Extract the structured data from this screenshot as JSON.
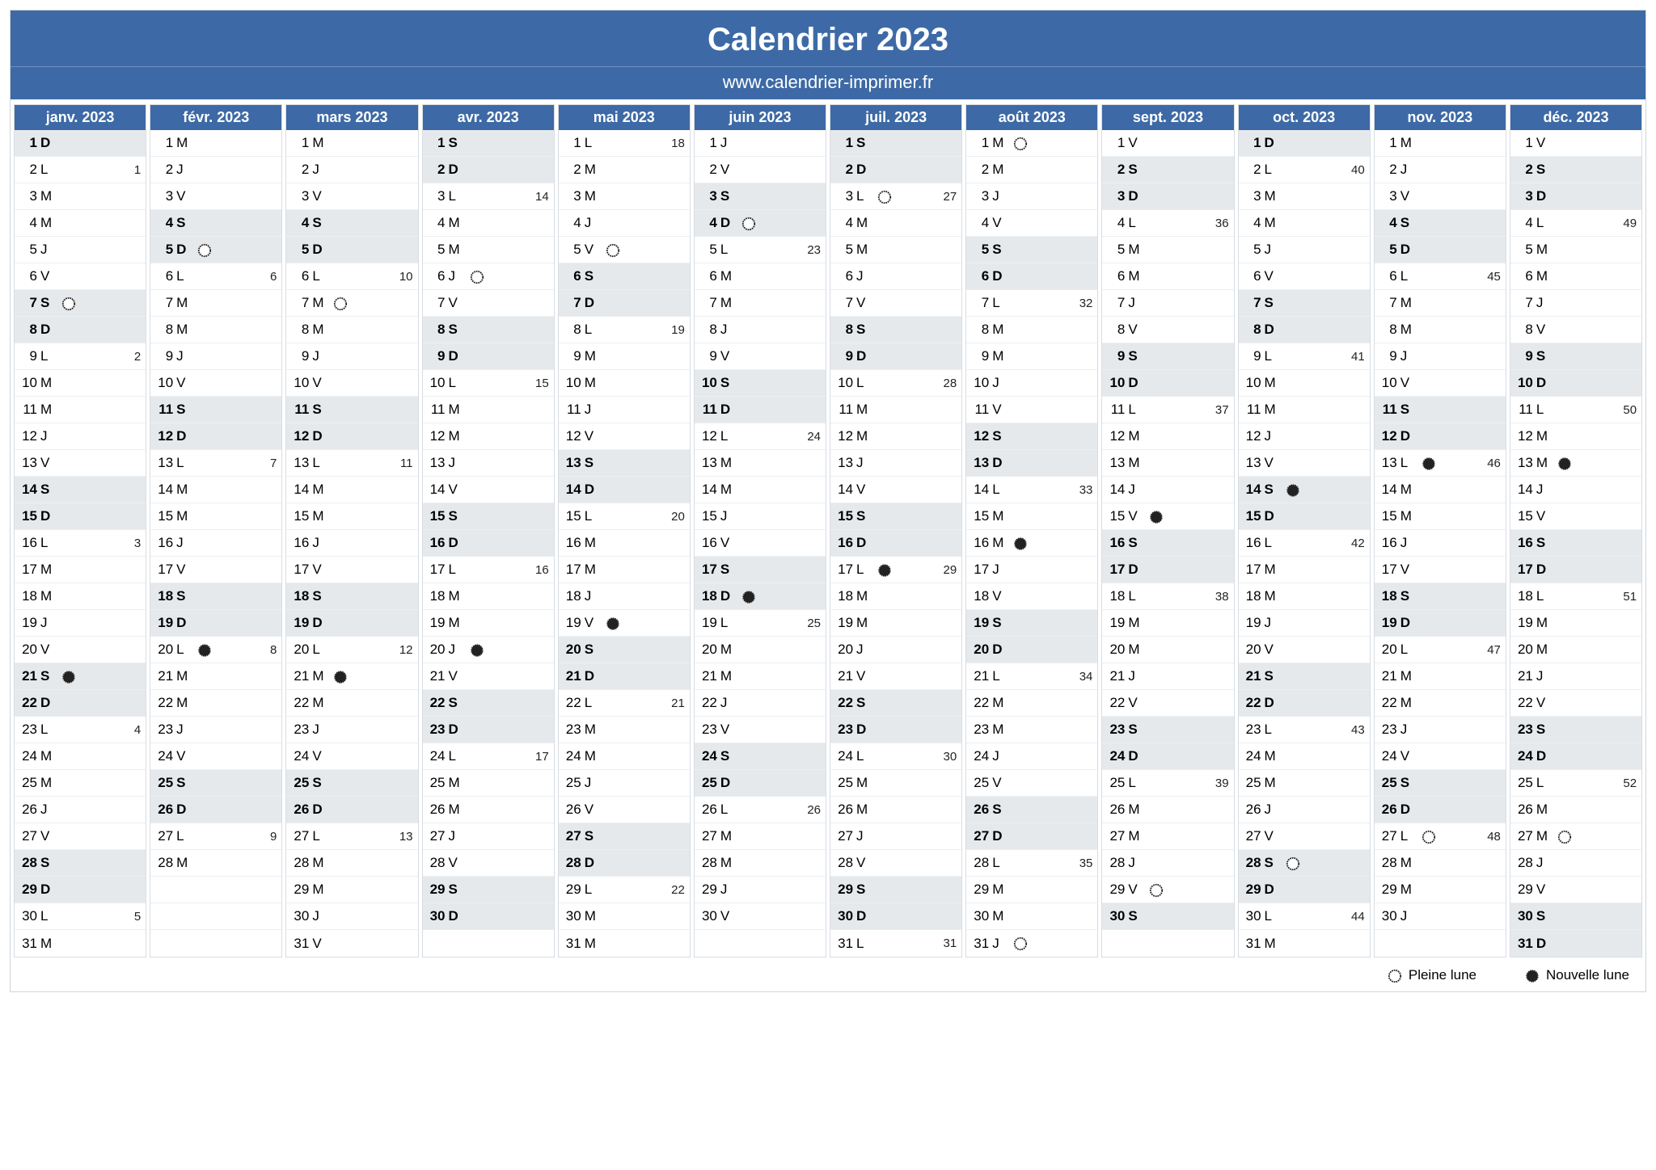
{
  "title": "Calendrier 2023",
  "subtitle": "www.calendrier-imprimer.fr",
  "legend": {
    "full": "Pleine lune",
    "new": "Nouvelle lune"
  },
  "dayAbbr": [
    "L",
    "M",
    "M",
    "J",
    "V",
    "S",
    "D"
  ],
  "months": [
    {
      "name": "janv. 2023",
      "startDow": 6,
      "len": 31,
      "moons": {
        "7": "full",
        "21": "new"
      },
      "weeks": {
        "2": "1",
        "9": "2",
        "16": "3",
        "23": "4",
        "30": "5"
      }
    },
    {
      "name": "févr. 2023",
      "startDow": 2,
      "len": 28,
      "moons": {
        "5": "full",
        "20": "new"
      },
      "weeks": {
        "6": "6",
        "13": "7",
        "20": "8",
        "27": "9"
      }
    },
    {
      "name": "mars 2023",
      "startDow": 2,
      "len": 31,
      "moons": {
        "7": "full",
        "21": "new"
      },
      "weeks": {
        "6": "10",
        "13": "11",
        "20": "12",
        "27": "13"
      }
    },
    {
      "name": "avr. 2023",
      "startDow": 5,
      "len": 30,
      "moons": {
        "6": "full",
        "20": "new"
      },
      "weeks": {
        "3": "14",
        "10": "15",
        "17": "16",
        "24": "17"
      }
    },
    {
      "name": "mai 2023",
      "startDow": 0,
      "len": 31,
      "moons": {
        "5": "full",
        "19": "new"
      },
      "weeks": {
        "1": "18",
        "8": "19",
        "15": "20",
        "22": "21",
        "29": "22"
      }
    },
    {
      "name": "juin 2023",
      "startDow": 3,
      "len": 30,
      "moons": {
        "4": "full",
        "18": "new"
      },
      "weeks": {
        "5": "23",
        "12": "24",
        "19": "25",
        "26": "26"
      }
    },
    {
      "name": "juil. 2023",
      "startDow": 5,
      "len": 31,
      "moons": {
        "3": "full",
        "17": "new"
      },
      "weeks": {
        "3": "27",
        "10": "28",
        "17": "29",
        "24": "30",
        "31": "31"
      }
    },
    {
      "name": "août 2023",
      "startDow": 1,
      "len": 31,
      "moons": {
        "1": "full",
        "16": "new",
        "31": "full"
      },
      "weeks": {
        "7": "32",
        "14": "33",
        "21": "34",
        "28": "35"
      }
    },
    {
      "name": "sept. 2023",
      "startDow": 4,
      "len": 30,
      "moons": {
        "15": "new",
        "29": "full"
      },
      "weeks": {
        "4": "36",
        "11": "37",
        "18": "38",
        "25": "39"
      }
    },
    {
      "name": "oct. 2023",
      "startDow": 6,
      "len": 31,
      "moons": {
        "14": "new",
        "28": "full"
      },
      "weeks": {
        "2": "40",
        "9": "41",
        "16": "42",
        "23": "43",
        "30": "44"
      }
    },
    {
      "name": "nov. 2023",
      "startDow": 2,
      "len": 30,
      "moons": {
        "13": "new",
        "27": "full"
      },
      "weeks": {
        "6": "45",
        "13": "46",
        "20": "47",
        "27": "48"
      }
    },
    {
      "name": "déc. 2023",
      "startDow": 4,
      "len": 31,
      "moons": {
        "13": "new",
        "27": "full"
      },
      "weeks": {
        "4": "49",
        "11": "50",
        "18": "51",
        "25": "52"
      }
    }
  ]
}
